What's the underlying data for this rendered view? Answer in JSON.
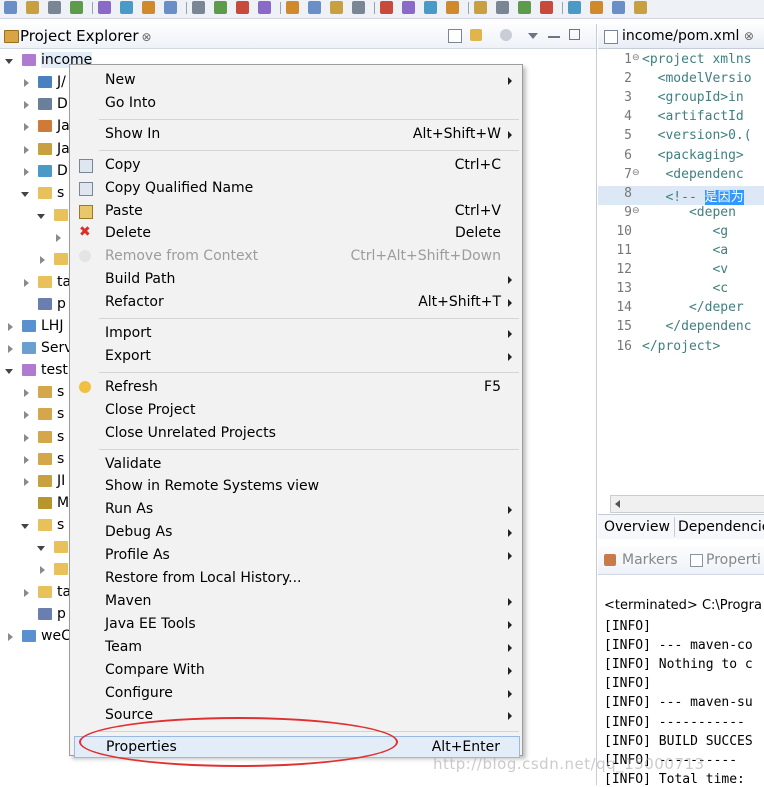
{
  "explorer": {
    "title": "Project Explorer",
    "close_glyph": "⊗",
    "tree": [
      {
        "label": "income",
        "indent": 0,
        "state": "open",
        "icon": "maven-project-icon"
      },
      {
        "label": "J/",
        "indent": 1,
        "state": "closed",
        "icon": "jax-ws-icon"
      },
      {
        "label": "D",
        "indent": 1,
        "state": "closed",
        "icon": "deployment-icon"
      },
      {
        "label": "Ja",
        "indent": 1,
        "state": "closed",
        "icon": "java-resources-icon"
      },
      {
        "label": "Ja",
        "indent": 1,
        "state": "closed",
        "icon": "libraries-icon"
      },
      {
        "label": "D",
        "indent": 1,
        "state": "closed",
        "icon": "deployed-resources-icon"
      },
      {
        "label": "s",
        "indent": 1,
        "state": "open",
        "icon": "folder-icon"
      },
      {
        "label": "",
        "indent": 2,
        "state": "open",
        "icon": "folder-icon"
      },
      {
        "label": "",
        "indent": 3,
        "state": "closed",
        "icon": "folder-icon"
      },
      {
        "label": "",
        "indent": 2,
        "state": "closed",
        "icon": "folder-icon"
      },
      {
        "label": "ta",
        "indent": 1,
        "state": "closed",
        "icon": "folder-icon"
      },
      {
        "label": "p",
        "indent": 1,
        "state": "none",
        "icon": "pom-file-icon"
      },
      {
        "label": "LHJ",
        "indent": 0,
        "state": "closed",
        "icon": "project-icon"
      },
      {
        "label": "Serv",
        "indent": 0,
        "state": "closed",
        "icon": "servers-folder-icon"
      },
      {
        "label": "test",
        "indent": 0,
        "state": "open",
        "icon": "maven-project-icon"
      },
      {
        "label": "s",
        "indent": 1,
        "state": "closed",
        "icon": "source-folder-icon"
      },
      {
        "label": "s",
        "indent": 1,
        "state": "closed",
        "icon": "source-folder-icon"
      },
      {
        "label": "s",
        "indent": 1,
        "state": "closed",
        "icon": "source-folder-icon"
      },
      {
        "label": "s",
        "indent": 1,
        "state": "closed",
        "icon": "source-folder-icon"
      },
      {
        "label": "JI",
        "indent": 1,
        "state": "closed",
        "icon": "libraries-icon"
      },
      {
        "label": "M",
        "indent": 1,
        "state": "none",
        "icon": "maven-deps-icon"
      },
      {
        "label": "s",
        "indent": 1,
        "state": "open",
        "icon": "folder-icon"
      },
      {
        "label": "",
        "indent": 2,
        "state": "open",
        "icon": "folder-icon"
      },
      {
        "label": "",
        "indent": 2,
        "state": "closed",
        "icon": "folder-icon"
      },
      {
        "label": "ta",
        "indent": 1,
        "state": "closed",
        "icon": "folder-icon"
      },
      {
        "label": "p",
        "indent": 1,
        "state": "none",
        "icon": "pom-file-icon"
      },
      {
        "label": "weC",
        "indent": 0,
        "state": "closed",
        "icon": "project-icon"
      }
    ]
  },
  "editor": {
    "tab_title": "income/pom.xml",
    "close_glyph": "⊗",
    "lines": [
      {
        "n": "1",
        "fold": "⊖",
        "text": "<project xmlns"
      },
      {
        "n": "2",
        "fold": "",
        "text": "  <modelVersio"
      },
      {
        "n": "3",
        "fold": "",
        "text": "  <groupId>in"
      },
      {
        "n": "4",
        "fold": "",
        "text": "  <artifactId"
      },
      {
        "n": "5",
        "fold": "",
        "text": "  <version>0.("
      },
      {
        "n": "6",
        "fold": "",
        "text": "  <packaging>"
      },
      {
        "n": "7",
        "fold": "⊖",
        "text": "   <dependenc"
      },
      {
        "n": "8",
        "fold": "",
        "text": "   <!-- ",
        "selected": "是因为"
      },
      {
        "n": "9",
        "fold": "⊖",
        "text": "      <depen"
      },
      {
        "n": "10",
        "fold": "",
        "text": "         <g"
      },
      {
        "n": "11",
        "fold": "",
        "text": "         <a"
      },
      {
        "n": "12",
        "fold": "",
        "text": "         <v"
      },
      {
        "n": "13",
        "fold": "",
        "text": "         <c"
      },
      {
        "n": "14",
        "fold": "",
        "text": "      </deper"
      },
      {
        "n": "15",
        "fold": "",
        "text": "   </dependenc"
      },
      {
        "n": "16",
        "fold": "",
        "text": "</project>"
      }
    ],
    "bottom_tabs": [
      "Overview",
      "Dependencie"
    ]
  },
  "console": {
    "tabs": [
      "Markers",
      "Properti"
    ],
    "terminated": "<terminated> C:\\Progra",
    "lines": [
      "[INFO]",
      "[INFO] --- maven-co",
      "[INFO] Nothing to c",
      "[INFO]",
      "[INFO] --- maven-su",
      "[INFO] -----------",
      "[INFO] BUILD SUCCES",
      "[INFO] ----------",
      "[INFO] Total time:"
    ]
  },
  "menu": {
    "items": [
      {
        "label": "New",
        "shortcut": "",
        "submenu": true,
        "icon": ""
      },
      {
        "label": "Go Into",
        "shortcut": "",
        "submenu": false,
        "icon": ""
      },
      {
        "sep": true
      },
      {
        "label": "Show In",
        "shortcut": "Alt+Shift+W",
        "submenu": true,
        "icon": ""
      },
      {
        "sep": true
      },
      {
        "label": "Copy",
        "shortcut": "Ctrl+C",
        "submenu": false,
        "icon": "copy-icon"
      },
      {
        "label": "Copy Qualified Name",
        "shortcut": "",
        "submenu": false,
        "icon": "copy-qualified-icon"
      },
      {
        "label": "Paste",
        "shortcut": "Ctrl+V",
        "submenu": false,
        "icon": "paste-icon"
      },
      {
        "label": "Delete",
        "shortcut": "Delete",
        "submenu": false,
        "icon": "delete-icon"
      },
      {
        "label": "Remove from Context",
        "shortcut": "Ctrl+Alt+Shift+Down",
        "submenu": false,
        "icon": "remove-context-icon",
        "disabled": true
      },
      {
        "label": "Build Path",
        "shortcut": "",
        "submenu": true,
        "icon": ""
      },
      {
        "label": "Refactor",
        "shortcut": "Alt+Shift+T",
        "submenu": true,
        "icon": ""
      },
      {
        "sep": true
      },
      {
        "label": "Import",
        "shortcut": "",
        "submenu": true,
        "icon": ""
      },
      {
        "label": "Export",
        "shortcut": "",
        "submenu": true,
        "icon": ""
      },
      {
        "sep": true
      },
      {
        "label": "Refresh",
        "shortcut": "F5",
        "submenu": false,
        "icon": "refresh-icon"
      },
      {
        "label": "Close Project",
        "shortcut": "",
        "submenu": false,
        "icon": ""
      },
      {
        "label": "Close Unrelated Projects",
        "shortcut": "",
        "submenu": false,
        "icon": ""
      },
      {
        "sep": true
      },
      {
        "label": "Validate",
        "shortcut": "",
        "submenu": false,
        "icon": ""
      },
      {
        "label": "Show in Remote Systems view",
        "shortcut": "",
        "submenu": false,
        "icon": ""
      },
      {
        "label": "Run As",
        "shortcut": "",
        "submenu": true,
        "icon": ""
      },
      {
        "label": "Debug As",
        "shortcut": "",
        "submenu": true,
        "icon": ""
      },
      {
        "label": "Profile As",
        "shortcut": "",
        "submenu": true,
        "icon": ""
      },
      {
        "label": "Restore from Local History...",
        "shortcut": "",
        "submenu": false,
        "icon": ""
      },
      {
        "label": "Maven",
        "shortcut": "",
        "submenu": true,
        "icon": ""
      },
      {
        "label": "Java EE Tools",
        "shortcut": "",
        "submenu": true,
        "icon": ""
      },
      {
        "label": "Team",
        "shortcut": "",
        "submenu": true,
        "icon": ""
      },
      {
        "label": "Compare With",
        "shortcut": "",
        "submenu": true,
        "icon": ""
      },
      {
        "label": "Configure",
        "shortcut": "",
        "submenu": true,
        "icon": ""
      },
      {
        "label": "Source",
        "shortcut": "",
        "submenu": true,
        "icon": ""
      },
      {
        "sep": true
      },
      {
        "label": "Properties",
        "shortcut": "Alt+Enter",
        "submenu": false,
        "icon": "",
        "hot": true
      }
    ]
  },
  "watermark": "http://blog.csdn.net/qq_15000713",
  "colors": {
    "annotation": "#e03030",
    "selection": "#3399ff",
    "highlight": "#e2edf8"
  }
}
